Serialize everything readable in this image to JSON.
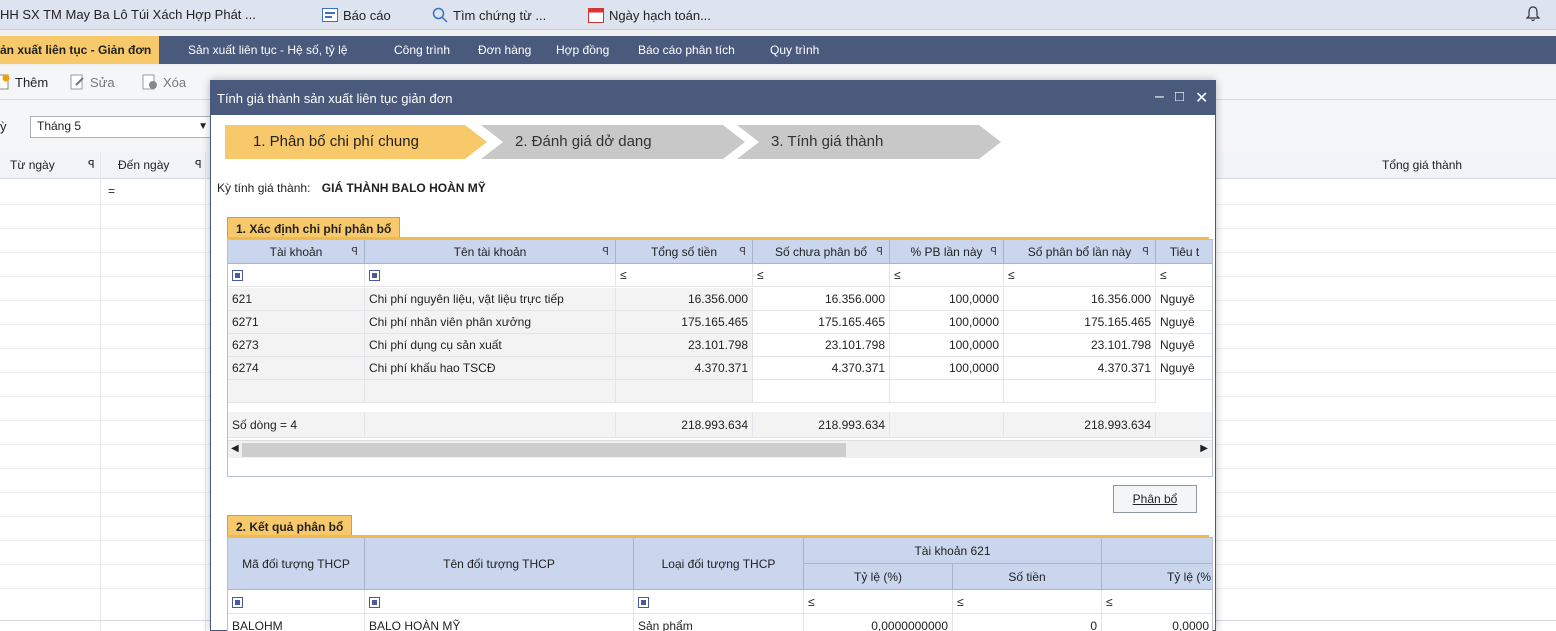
{
  "topbar": {
    "company": "HH SX TM May Ba Lô Túi Xách Hợp Phát ...",
    "report": "Báo cáo",
    "search": "Tìm chứng từ ...",
    "date": "Ngày hạch toán..."
  },
  "menu": {
    "items": [
      "ản xuất liên tục - Giản đơn",
      "Sản xuất liên tục - Hệ số, tỷ lệ",
      "Công trình",
      "Đơn hàng",
      "Hợp đồng",
      "Báo cáo phân tích",
      "Quy trình"
    ]
  },
  "toolbar": {
    "add": "Thêm",
    "edit": "Sửa",
    "delete": "Xóa"
  },
  "filter": {
    "label": "ỳ",
    "period": "Tháng 5"
  },
  "bggrid": {
    "col_from": "Từ ngày",
    "col_to": "Đến ngày",
    "col_total": "Tổng giá thành",
    "filter_eq": "="
  },
  "dialog": {
    "title": "Tính giá thành sản xuất liên tục giản đơn",
    "steps": [
      "1. Phân bổ chi phí chung",
      "2. Đánh giá dở dang",
      "3. Tính giá thành"
    ],
    "period_label": "Kỳ tính giá thành:",
    "period_value": "GIÁ THÀNH BALO HOÀN MỸ",
    "section1": "1. Xác định chi phí phân bổ",
    "section2": "2. Kết quả phân bổ",
    "allocate_button": "Phân bổ"
  },
  "table1": {
    "headers": [
      "Tài khoản",
      "Tên tài khoản",
      "Tổng số tiền",
      "Số chưa phân bổ",
      "% PB lần này",
      "Số phân bổ lần này",
      "Tiêu t"
    ],
    "filter_sym": "≤",
    "rows": [
      {
        "acct": "621",
        "name": "Chi phí nguyên liệu, vật liệu trực tiếp",
        "total": "16.356.000",
        "unalloc": "16.356.000",
        "pct": "100,0000",
        "alloc": "16.356.000",
        "crit": "Nguyê"
      },
      {
        "acct": "6271",
        "name": "Chi phí nhân viên phân xưởng",
        "total": "175.165.465",
        "unalloc": "175.165.465",
        "pct": "100,0000",
        "alloc": "175.165.465",
        "crit": "Nguyê"
      },
      {
        "acct": "6273",
        "name": "Chi phí dụng cụ sản xuất",
        "total": "23.101.798",
        "unalloc": "23.101.798",
        "pct": "100,0000",
        "alloc": "23.101.798",
        "crit": "Nguyê"
      },
      {
        "acct": "6274",
        "name": "Chi phí khấu hao TSCĐ",
        "total": "4.370.371",
        "unalloc": "4.370.371",
        "pct": "100,0000",
        "alloc": "4.370.371",
        "crit": "Nguyê"
      }
    ],
    "footer": {
      "count": "Số dòng = 4",
      "total": "218.993.634",
      "unalloc": "218.993.634",
      "alloc": "218.993.634"
    }
  },
  "table2": {
    "headers": {
      "code": "Mã đối tượng THCP",
      "name": "Tên đối tượng THCP",
      "type": "Loại đối tượng THCP",
      "acct_group": "Tài khoản 621",
      "ratio": "Tỷ lệ (%)",
      "amount": "Số tiền",
      "ratio2": "Tỷ lệ (%"
    },
    "filter_sym": "≤",
    "row": {
      "code": "BALOHM",
      "name": "BALO HOÀN MỸ",
      "type": "Sản phẩm",
      "ratio": "0,0000000000",
      "amount": "0",
      "ratio2": "0,0000"
    }
  }
}
